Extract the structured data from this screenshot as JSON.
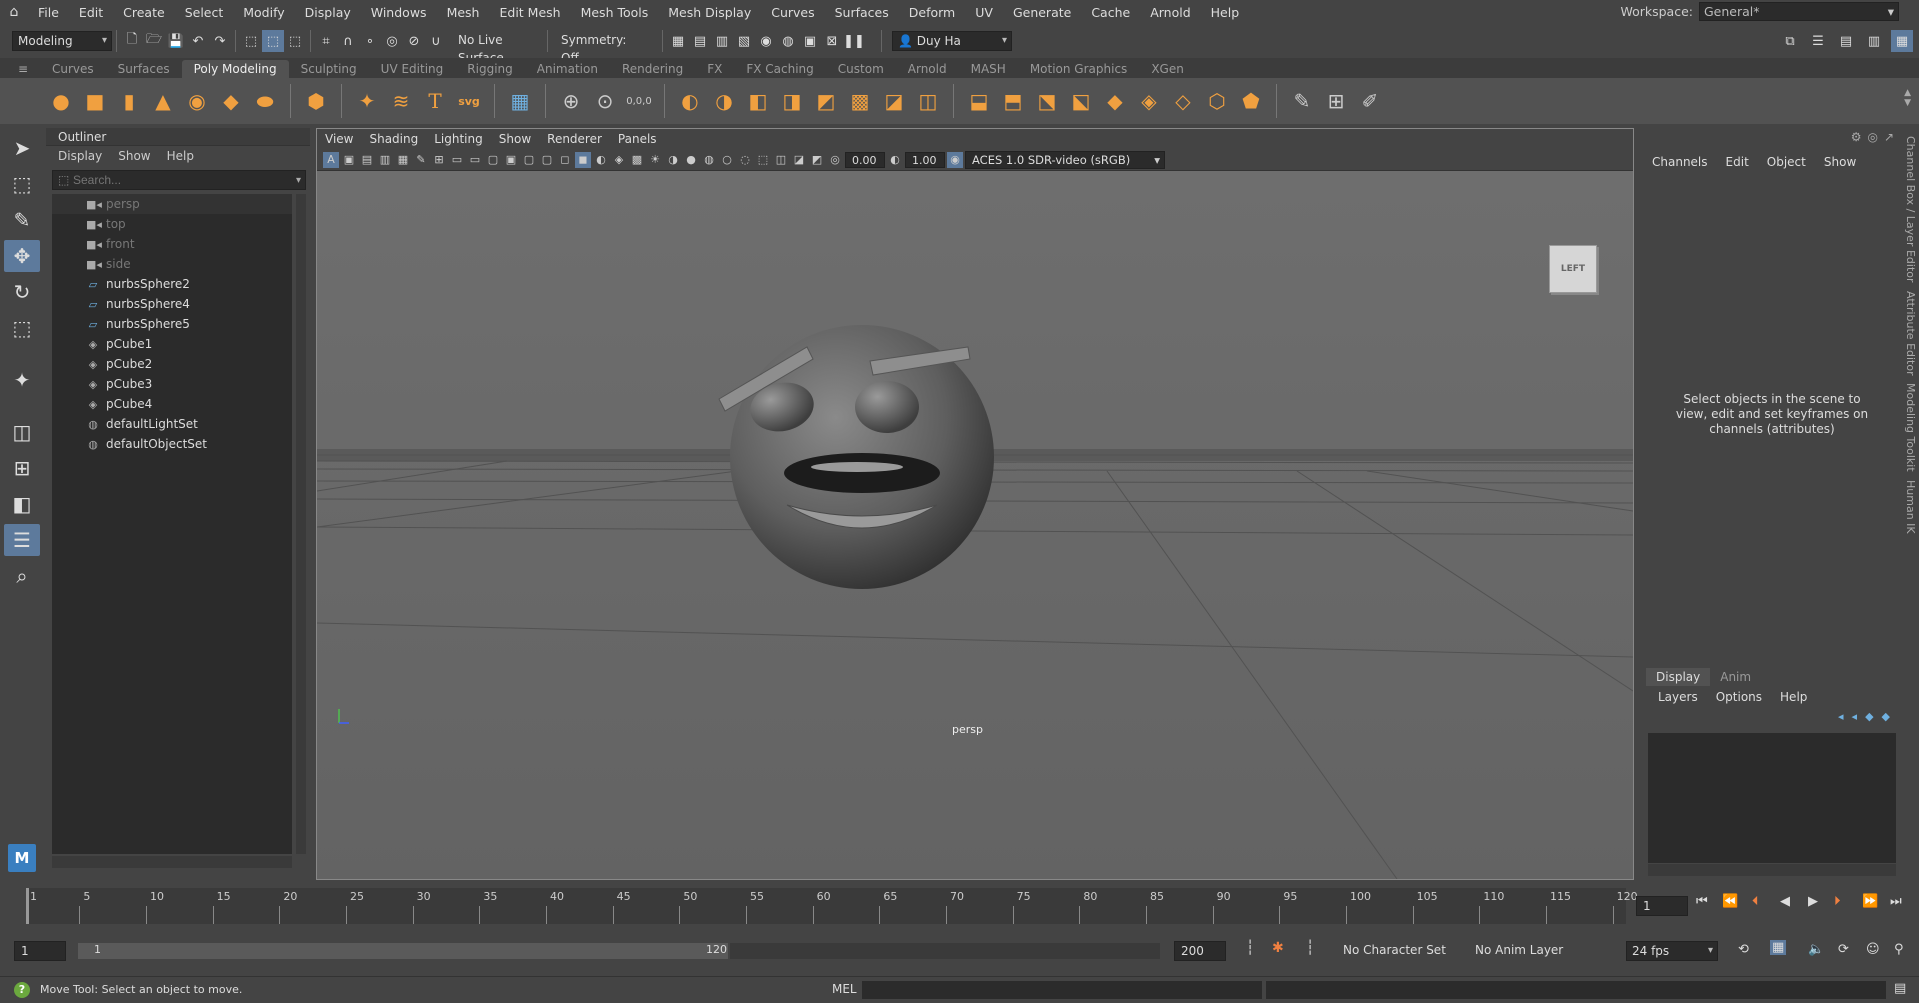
{
  "menubar": {
    "items": [
      "File",
      "Edit",
      "Create",
      "Select",
      "Modify",
      "Display",
      "Windows",
      "Mesh",
      "Edit Mesh",
      "Mesh Tools",
      "Mesh Display",
      "Curves",
      "Surfaces",
      "Deform",
      "UV",
      "Generate",
      "Cache",
      "Arnold",
      "Help"
    ],
    "workspace_label": "Workspace:",
    "workspace_value": "General*"
  },
  "statusline": {
    "mode": "Modeling",
    "live_surface": "No Live Surface",
    "symmetry": "Symmetry: Off",
    "user": "Duy Ha"
  },
  "shelf": {
    "tabs": [
      "Curves",
      "Surfaces",
      "Poly Modeling",
      "Sculpting",
      "UV Editing",
      "Rigging",
      "Animation",
      "Rendering",
      "FX",
      "FX Caching",
      "Custom",
      "Arnold",
      "MASH",
      "Motion Graphics",
      "XGen"
    ],
    "active_tab": "Poly Modeling",
    "text_tool_label": "T",
    "svg_tool_label": "svg",
    "snap_label": "0,0,0"
  },
  "outliner": {
    "title": "Outliner",
    "menu": [
      "Display",
      "Show",
      "Help"
    ],
    "search_placeholder": "Search...",
    "items": [
      {
        "name": "persp",
        "icon": "camera-icon",
        "dim": true
      },
      {
        "name": "top",
        "icon": "camera-icon",
        "dim": true
      },
      {
        "name": "front",
        "icon": "camera-icon",
        "dim": true
      },
      {
        "name": "side",
        "icon": "camera-icon",
        "dim": true
      },
      {
        "name": "nurbsSphere2",
        "icon": "nurbs-icon",
        "dim": false
      },
      {
        "name": "nurbsSphere4",
        "icon": "nurbs-icon",
        "dim": false
      },
      {
        "name": "nurbsSphere5",
        "icon": "nurbs-icon",
        "dim": false
      },
      {
        "name": "pCube1",
        "icon": "poly-icon",
        "dim": false
      },
      {
        "name": "pCube2",
        "icon": "poly-icon",
        "dim": false
      },
      {
        "name": "pCube3",
        "icon": "poly-icon",
        "dim": false
      },
      {
        "name": "pCube4",
        "icon": "poly-icon",
        "dim": false
      },
      {
        "name": "defaultLightSet",
        "icon": "set-icon",
        "dim": false
      },
      {
        "name": "defaultObjectSet",
        "icon": "set-icon",
        "dim": false
      }
    ]
  },
  "viewport": {
    "menu": [
      "View",
      "Shading",
      "Lighting",
      "Show",
      "Renderer",
      "Panels"
    ],
    "exposure": "0.00",
    "gamma": "1.00",
    "color_space": "ACES 1.0 SDR-video (sRGB)",
    "viewcube_label": "LEFT",
    "camera_label": "persp",
    "bg_color": "#6b6b6b"
  },
  "channelbox": {
    "menu": [
      "Channels",
      "Edit",
      "Object",
      "Show"
    ],
    "message": "Select objects in the scene to view, edit and set keyframes on channels (attributes)",
    "layer_tabs": [
      "Display",
      "Anim"
    ],
    "layer_menu": [
      "Layers",
      "Options",
      "Help"
    ],
    "side_tabs": [
      "Channel Box / Layer Editor",
      "Attribute Editor",
      "Modeling Toolkit",
      "Human IK"
    ]
  },
  "timeslider": {
    "ticks": [
      "1",
      "5",
      "10",
      "15",
      "20",
      "25",
      "30",
      "35",
      "40",
      "45",
      "50",
      "55",
      "60",
      "65",
      "70",
      "75",
      "80",
      "85",
      "90",
      "95",
      "100",
      "105",
      "110",
      "115",
      "120"
    ],
    "current_frame": "1"
  },
  "rangeslider": {
    "start": "1",
    "range_start": "1",
    "range_end": "120",
    "end": "200",
    "character_set": "No Character Set",
    "anim_layer": "No Anim Layer",
    "fps": "24 fps"
  },
  "statusbar": {
    "help_text": "Move Tool: Select an object to move.",
    "cmd_lang": "MEL"
  }
}
